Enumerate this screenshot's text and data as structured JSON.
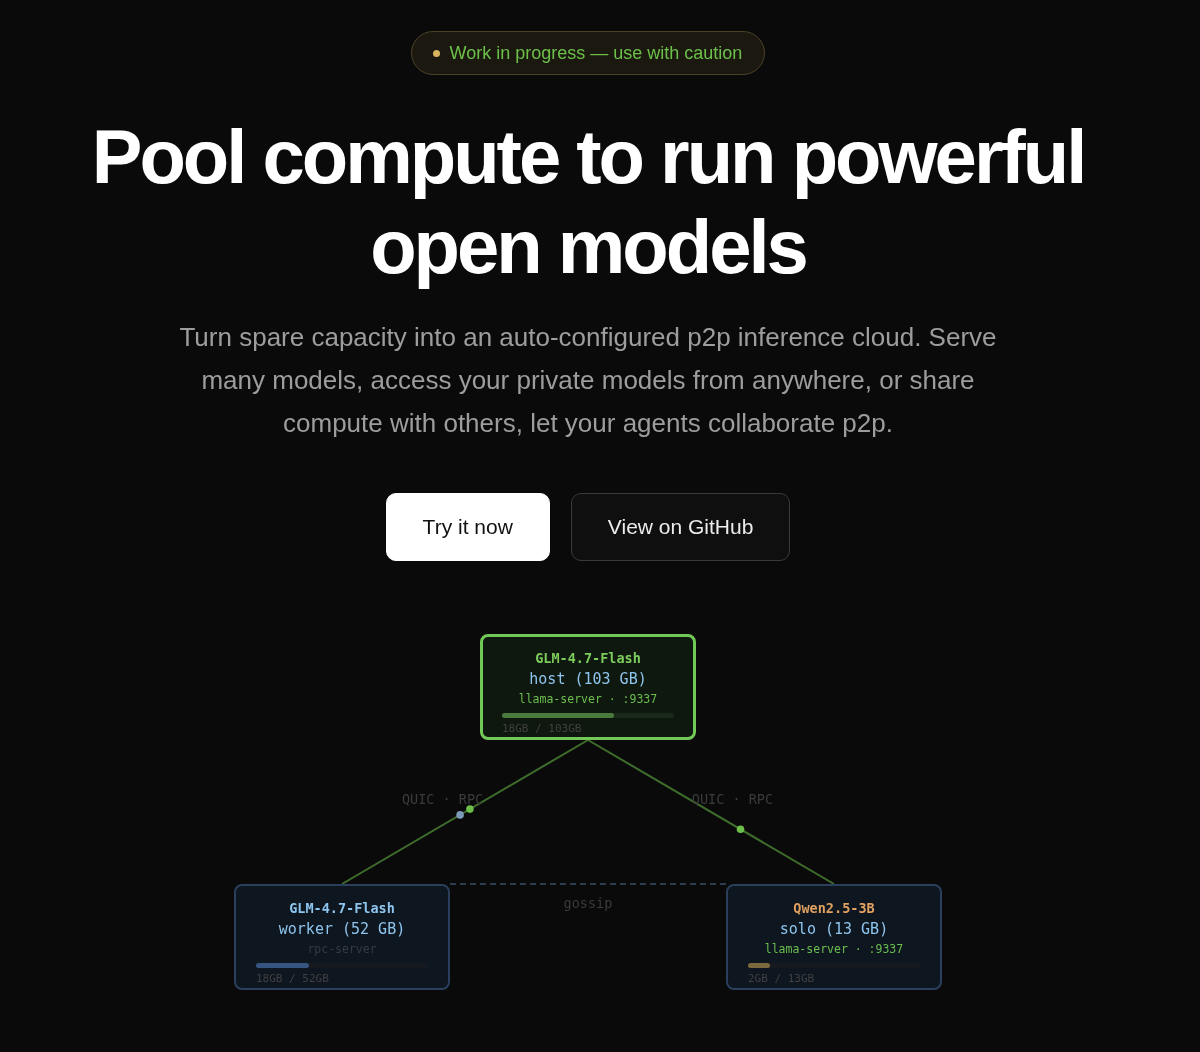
{
  "badge": {
    "text": "Work in progress — use with caution"
  },
  "headline": "Pool compute to run powerful open models",
  "subtitle": "Turn spare capacity into an auto-configured p2p inference cloud. Serve many models, access your private models from anywhere, or share compute with others, let your agents collaborate p2p.",
  "buttons": [
    {
      "label": "Try it now",
      "kind": "primary"
    },
    {
      "label": "View on GitHub",
      "kind": "secondary"
    }
  ],
  "diagram": {
    "nodes": [
      {
        "kind": "host",
        "model": "GLM-4.7-Flash",
        "color": "#7ccc5c",
        "role": "host (103 GB)",
        "service": "llama-server · :9337",
        "usage": "18GB / 103GB",
        "level": 0.65
      },
      {
        "kind": "worker",
        "model": "GLM-4.7-Flash",
        "color": "#8ec5ee",
        "role": "worker (52 GB)",
        "service": "rpc-server",
        "usage": "18GB / 52GB",
        "level": 0.31
      },
      {
        "kind": "solo",
        "model": "Qwen2.5-3B",
        "color": "#e0a060",
        "role": "solo (13 GB)",
        "service": "llama-server · :9337",
        "usage": "2GB / 13GB",
        "level": 0.13
      }
    ],
    "links": [
      {
        "label": "QUIC · RPC",
        "packets": [
          {
            "color": "#6cc04a"
          },
          {
            "color": "#7a9ab8"
          }
        ]
      },
      {
        "label": "QUIC · RPC",
        "packets": [
          {
            "color": "#6cc04a"
          }
        ]
      }
    ],
    "gossip": {
      "label": "gossip"
    }
  }
}
